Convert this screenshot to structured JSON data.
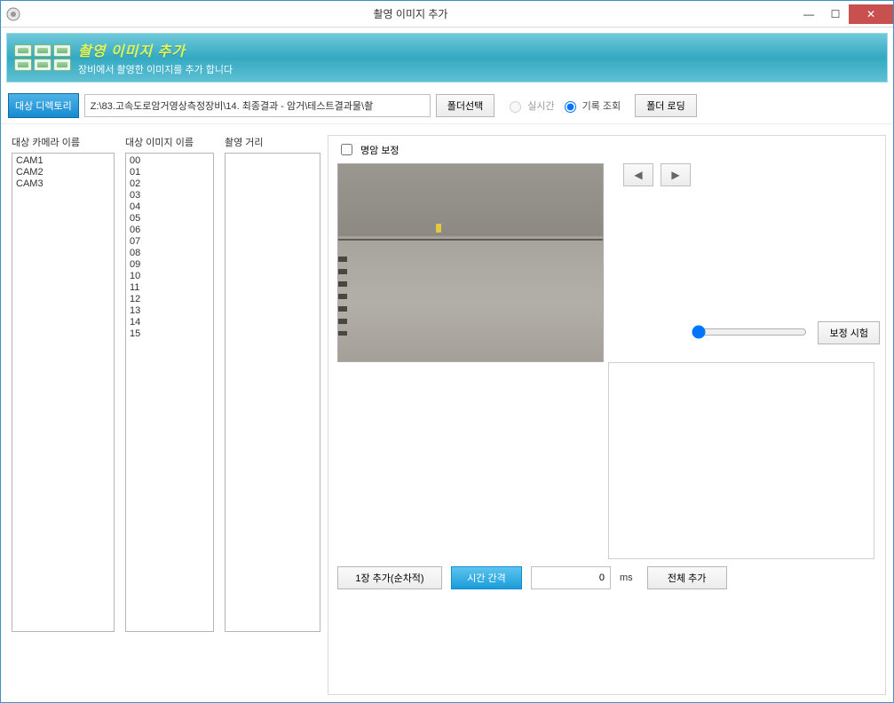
{
  "window": {
    "title": "촬영 이미지 추가"
  },
  "header": {
    "title": "촬영 이미지 추가",
    "subtitle": "장비에서 촬영한 이미지를 추가 합니다"
  },
  "toolbar": {
    "target_dir_label": "대상 디렉토리",
    "path_value": "Z:\\83.고속도로암거영상측정장비\\14. 최종결과 - 암거\\테스트결과물\\촬",
    "select_folder": "폴더선택",
    "radio_realtime": "실시간",
    "radio_history": "기록 조회",
    "folder_loading": "폴더 로딩"
  },
  "columns": {
    "camera_label": "대상 카메라 이름",
    "image_label": "대상 이미지 이름",
    "distance_label": "촬영 거리"
  },
  "cameras": [
    "CAM1",
    "CAM2",
    "CAM3"
  ],
  "images": [
    "00",
    "01",
    "02",
    "03",
    "04",
    "05",
    "06",
    "07",
    "08",
    "09",
    "10",
    "11",
    "12",
    "13",
    "14",
    "15"
  ],
  "right": {
    "brightness_correction": "명암 보정",
    "correction_test": "보정 시험"
  },
  "bottom": {
    "add_one_seq": "1장 추가(순차적)",
    "time_interval": "시간 간격",
    "interval_value": "0",
    "interval_unit": "ms",
    "add_all": "전체 추가"
  },
  "icons": {
    "prev": "◀",
    "next": "▶",
    "minimize": "—",
    "maximize": "☐",
    "close": "✕"
  }
}
